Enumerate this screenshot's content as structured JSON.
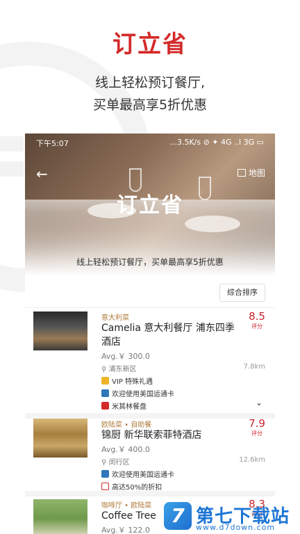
{
  "promo": {
    "title": "订立省",
    "line1": "线上轻松预订餐厅,",
    "line2": "买单最高享5折优惠"
  },
  "status_bar": {
    "time": "下午5:07",
    "indicators": "...3.5K/s ⊘ ✦ 4G ..l 3G ▭"
  },
  "nav": {
    "back_icon": "arrow-left-icon",
    "map_label": "地图"
  },
  "hero": {
    "title": "订立省",
    "subtitle": "线上轻松预订餐厅，买单最高享5折优惠"
  },
  "sort_label": "综合排序",
  "restaurants": [
    {
      "category": "意大利菜",
      "name": "Camelia 意大利餐厅 浦东四季酒店",
      "avg": "Avg.￥ 300.0",
      "location": "浦东新区",
      "distance": "7.8km",
      "score": "8.5",
      "score_label": "评分",
      "features": [
        "VIP 特殊礼遇",
        "欢迎使用美国运通卡",
        "米其林餐盘"
      ]
    },
    {
      "category": "欧陆菜 • 自助餐",
      "name": "锦厨 新华联索菲特酒店",
      "avg": "Avg.￥ 400.0",
      "location": "闵行区",
      "distance": "12.6km",
      "score": "7.9",
      "score_label": "评分",
      "features": [
        "欢迎使用美国运通卡",
        "高达50%的折扣"
      ]
    },
    {
      "category": "咖啡厅 • 欧陆菜",
      "name": "Coffee Tree",
      "avg": "Avg.￥ 122.0",
      "score": "8.3",
      "score_label": "评分"
    }
  ],
  "watermark": {
    "logo": "7",
    "title": "第七下载站",
    "url": "www.d7down.com"
  },
  "colors": {
    "brand_red": "#d42a2a",
    "score_red": "#c8242c",
    "category_gold": "#b07a3a"
  }
}
